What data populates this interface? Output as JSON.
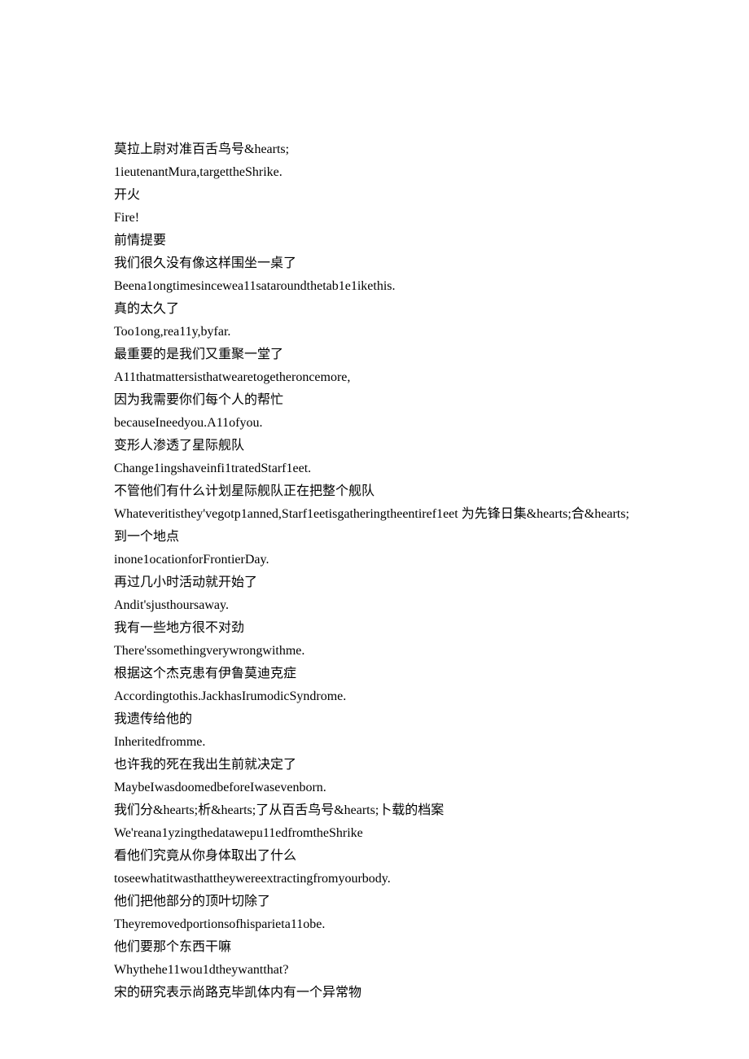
{
  "lines": [
    "莫拉上尉对准百舌鸟号&hearts;",
    "1ieutenantMura,targettheShrike.",
    "开火",
    "Fire!",
    "前情提要",
    "我们很久没有像这样围坐一桌了",
    "Beena1ongtimesincewea11sataroundthetab1e1ikethis.",
    "真的太久了",
    "Too1ong,rea11y,byfar.",
    "最重要的是我们又重聚一堂了",
    "A11thatmattersisthatwearetogetheroncemore,",
    "因为我需要你们每个人的帮忙",
    "becauseIneedyou.A11ofyou.",
    "变形人渗透了星际舰队",
    "Change1ingshaveinfi1tratedStarf1eet.",
    "不管他们有什么计划星际舰队正在把整个舰队",
    "Whateveritisthey'vegotp1anned,Starf1eetisgatheringtheentiref1eet 为先锋日集&hearts;合&hearts;到一个地点",
    "inone1ocationforFrontierDay.",
    "再过几小时活动就开始了",
    "Andit'sjusthoursaway.",
    "我有一些地方很不对劲",
    "There'ssomethingverywrongwithme.",
    "根据这个杰克患有伊鲁莫迪克症",
    "Accordingtothis.JackhasIrumodicSyndrome.",
    "我遗传给他的",
    "Inheritedfromme.",
    "也许我的死在我出生前就决定了",
    "MaybeIwasdoomedbeforeIwasevenborn.",
    "我们分&hearts;析&hearts;了从百舌鸟号&hearts;卜载的档案",
    "We'reana1yzingthedatawepu11edfromtheShrike",
    "看他们究竟从你身体取出了什么",
    "toseewhatitwasthattheywereextractingfromyourbody.",
    "他们把他部分的顶叶切除了",
    "Theyremovedportionsofhisparieta11obe.",
    "他们要那个东西干嘛",
    "Whythehe11wou1dtheywantthat?",
    "宋的研究表示尚路克毕凯体内有一个异常物"
  ]
}
